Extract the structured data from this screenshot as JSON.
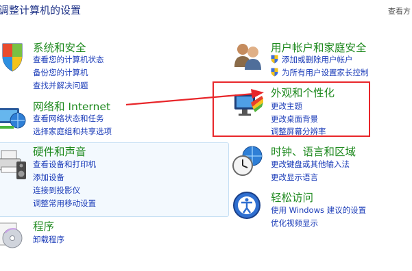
{
  "page": {
    "title": "调整计算机的设置",
    "view_by": "查看方"
  },
  "categories": [
    {
      "id": "system",
      "title": "系统和安全",
      "links": [
        "查看您的计算机状态",
        "备份您的计算机",
        "查找并解决问题"
      ]
    },
    {
      "id": "network",
      "title": "网络和 Internet",
      "links": [
        "查看网络状态和任务",
        "选择家庭组和共享选项"
      ]
    },
    {
      "id": "hardware",
      "title": "硬件和声音",
      "links": [
        "查看设备和打印机",
        "添加设备",
        "连接到投影仪",
        "调整常用移动设置"
      ]
    },
    {
      "id": "programs",
      "title": "程序",
      "links": [
        "卸载程序"
      ]
    },
    {
      "id": "users",
      "title": "用户帐户和家庭安全",
      "links": [
        "添加或删除用户帐户",
        "为所有用户设置家长控制"
      ]
    },
    {
      "id": "appearance",
      "title": "外观和个性化",
      "links": [
        "更改主题",
        "更改桌面背景",
        "调整屏幕分辨率"
      ]
    },
    {
      "id": "clock",
      "title": "时钟、语言和区域",
      "links": [
        "更改键盘或其他输入法",
        "更改显示语言"
      ]
    },
    {
      "id": "ease",
      "title": "轻松访问",
      "links": [
        "使用 Windows 建议的设置",
        "优化视频显示"
      ]
    }
  ],
  "colors": {
    "category_title": "#1f8a1f",
    "link": "#1a3bb8",
    "highlight_box": "#e8262a",
    "arrow": "#e8262a"
  },
  "icons": {
    "system": "shield-flag-icon",
    "network": "network-globe-icon",
    "hardware": "printer-speaker-icon",
    "programs": "program-disc-icon",
    "users": "users-icon",
    "appearance": "monitor-palette-icon",
    "clock": "clock-globe-icon",
    "ease": "accessibility-icon"
  }
}
